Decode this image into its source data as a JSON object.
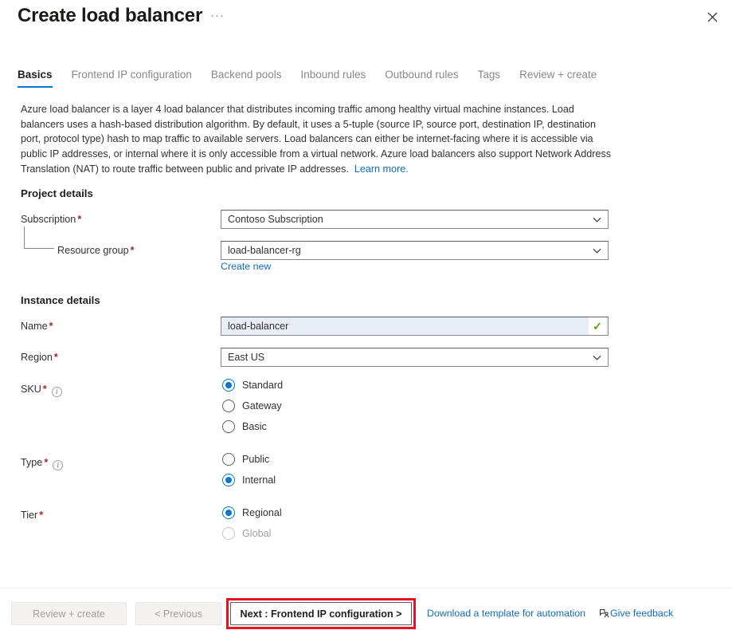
{
  "header": {
    "title": "Create load balancer",
    "ellipsis": "···",
    "close_icon": "close-icon"
  },
  "tabs": [
    {
      "label": "Basics",
      "active": true
    },
    {
      "label": "Frontend IP configuration",
      "active": false
    },
    {
      "label": "Backend pools",
      "active": false
    },
    {
      "label": "Inbound rules",
      "active": false
    },
    {
      "label": "Outbound rules",
      "active": false
    },
    {
      "label": "Tags",
      "active": false
    },
    {
      "label": "Review + create",
      "active": false
    }
  ],
  "description": {
    "text": "Azure load balancer is a layer 4 load balancer that distributes incoming traffic among healthy virtual machine instances. Load balancers uses a hash-based distribution algorithm. By default, it uses a 5-tuple (source IP, source port, destination IP, destination port, protocol type) hash to map traffic to available servers. Load balancers can either be internet-facing where it is accessible via public IP addresses, or internal where it is only accessible from a virtual network. Azure load balancers also support Network Address Translation (NAT) to route traffic between public and private IP addresses.",
    "learn_more": "Learn more."
  },
  "project_details": {
    "section_title": "Project details",
    "subscription": {
      "label": "Subscription",
      "required": "*",
      "value": "Contoso Subscription"
    },
    "resource_group": {
      "label": "Resource group",
      "required": "*",
      "value": "load-balancer-rg",
      "create_new": "Create new"
    }
  },
  "instance_details": {
    "section_title": "Instance details",
    "name": {
      "label": "Name",
      "required": "*",
      "value": "load-balancer",
      "valid_icon": "checkmark-icon"
    },
    "region": {
      "label": "Region",
      "required": "*",
      "value": "East US"
    },
    "sku": {
      "label": "SKU",
      "required": "*",
      "info": "info-icon",
      "options": [
        {
          "label": "Standard",
          "selected": true,
          "disabled": false
        },
        {
          "label": "Gateway",
          "selected": false,
          "disabled": false
        },
        {
          "label": "Basic",
          "selected": false,
          "disabled": false
        }
      ]
    },
    "type": {
      "label": "Type",
      "required": "*",
      "info": "info-icon",
      "options": [
        {
          "label": "Public",
          "selected": false,
          "disabled": false
        },
        {
          "label": "Internal",
          "selected": true,
          "disabled": false
        }
      ]
    },
    "tier": {
      "label": "Tier",
      "required": "*",
      "options": [
        {
          "label": "Regional",
          "selected": true,
          "disabled": false
        },
        {
          "label": "Global",
          "selected": false,
          "disabled": true
        }
      ]
    }
  },
  "footer": {
    "review_create": "Review + create",
    "previous": "< Previous",
    "next": "Next : Frontend IP configuration >",
    "download_template": "Download a template for automation",
    "give_feedback": "Give feedback"
  },
  "colors": {
    "accent": "#0078d4",
    "link": "#0f6cbd",
    "required": "#a4262c",
    "highlight": "#e81123",
    "valid": "#57a300",
    "focus_field_bg": "#e9edf7"
  }
}
